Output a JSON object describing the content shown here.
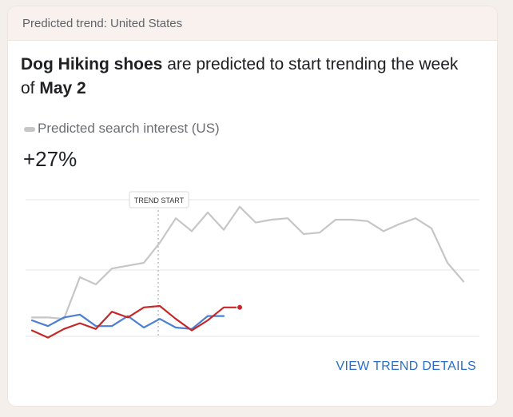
{
  "header": {
    "title": "Predicted trend: United States"
  },
  "headline": {
    "subject": "Dog Hiking shoes",
    "middle": " are predicted to start trending the week of ",
    "date": "May 2"
  },
  "legend": {
    "label": "Predicted search interest (US)"
  },
  "change": "+27%",
  "chart_data": {
    "type": "line",
    "annotation": "TREND START",
    "trend_start_index": 8,
    "ylim": [
      0,
      100
    ],
    "grid": true,
    "series": [
      {
        "color": "#4a7fd4",
        "values": [
          15,
          11,
          17,
          19,
          11,
          11,
          18,
          10,
          16,
          10,
          9,
          18,
          18
        ]
      },
      {
        "color": "#c62828",
        "values": [
          8,
          3,
          9,
          13,
          9,
          21,
          17,
          24,
          25,
          16,
          8,
          15,
          24,
          24
        ]
      },
      {
        "color": "#c6c6c6",
        "values": [
          17,
          17,
          16,
          45,
          40,
          51,
          53,
          55,
          69,
          86,
          77,
          90,
          78,
          94,
          83,
          85,
          86,
          75,
          76,
          85,
          85,
          84,
          77,
          82,
          86,
          79,
          55,
          42
        ]
      }
    ],
    "colors": {
      "gray": "#c6c6c6",
      "blue": "#4a7fd4",
      "red": "#c62828",
      "grid": "#e6e6e6"
    }
  },
  "actions": {
    "details_label": "VIEW TREND DETAILS"
  }
}
